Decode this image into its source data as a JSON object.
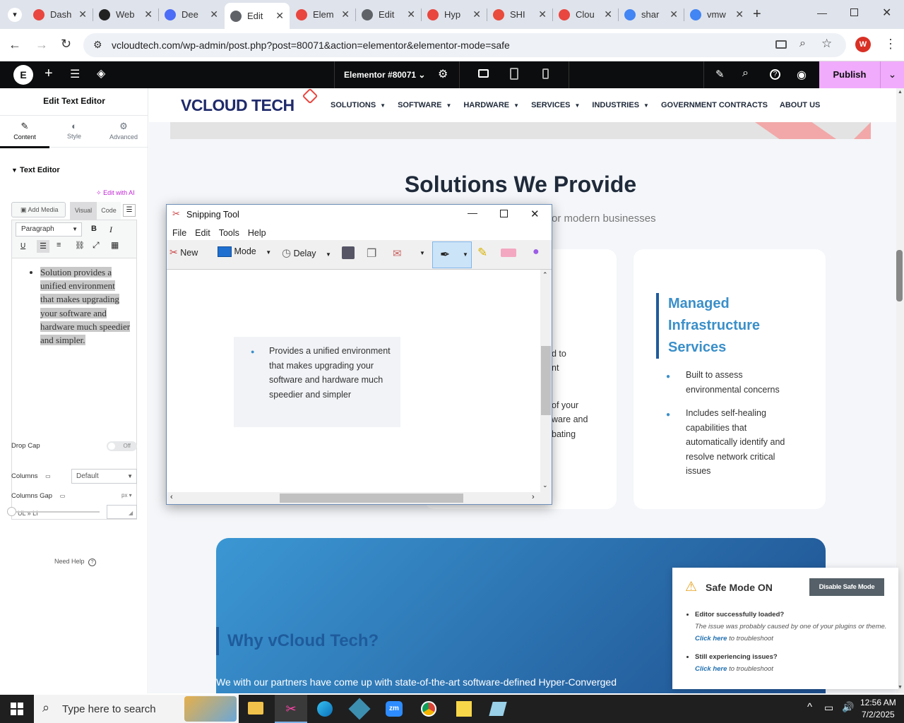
{
  "browser": {
    "tabs": [
      {
        "label": "Dash",
        "color": "#e9463f",
        "active": false
      },
      {
        "label": "Web",
        "color": "#222222",
        "active": false
      },
      {
        "label": "Dee",
        "color": "#4a6cf7",
        "active": false
      },
      {
        "label": "Edit",
        "color": "#5f6368",
        "active": true
      },
      {
        "label": "Elem",
        "color": "#e9463f",
        "active": false
      },
      {
        "label": "Edit",
        "color": "#5f6368",
        "active": false
      },
      {
        "label": "Hyp",
        "color": "#e9463f",
        "active": false
      },
      {
        "label": "SHI",
        "color": "#e94b3c",
        "active": false
      },
      {
        "label": "Clou",
        "color": "#e9463f",
        "active": false
      },
      {
        "label": "shar",
        "color": "#4285f4",
        "active": false
      },
      {
        "label": "vmw",
        "color": "#4285f4",
        "active": false
      }
    ],
    "url": "vcloudtech.com/wp-admin/post.php?post=80071&action=elementor&elementor-mode=safe",
    "profile_initial": "W"
  },
  "elementor_bar": {
    "document_title": "Elementor #80071",
    "publish_label": "Publish"
  },
  "panel": {
    "title": "Edit Text Editor",
    "tabs": [
      "Content",
      "Style",
      "Advanced"
    ],
    "section_title": "Text Editor",
    "edit_with_ai": "Edit with AI",
    "add_media": "Add Media",
    "visual_tab": "Visual",
    "code_tab": "Code",
    "format_select": "Paragraph",
    "editor_text": "Solution provides a unified environment that makes upgrading your software and hardware much speedier and simpler.",
    "path": "UL » LI",
    "drop_cap_label": "Drop Cap",
    "drop_cap_value": "Off",
    "columns_label": "Columns",
    "columns_value": "Default",
    "columns_gap_label": "Columns Gap",
    "columns_gap_unit": "px",
    "need_help": "Need Help"
  },
  "site": {
    "logo": "VCLOUD TECH",
    "nav": [
      "SOLUTIONS",
      "SOFTWARE",
      "HARDWARE",
      "SERVICES",
      "INDUSTRIES",
      "GOVERNMENT CONTRACTS",
      "ABOUT US"
    ],
    "section_title": "Solutions We Provide",
    "section_sub_fragment": "or modern businesses",
    "card_partial_lines": [
      "d to",
      "nt",
      "of your",
      "ware and",
      "bating"
    ],
    "card3_title": "Managed Infrastructure Services",
    "card3_items": [
      "Built to assess environmental concerns",
      "Includes self-healing capabilities that automatically identify and resolve network critical issues"
    ],
    "why_title": "Why vCloud Tech?",
    "why_text": "We with our partners have come up with state-of-the-art software-defined Hyper-Converged"
  },
  "snipping": {
    "title": "Snipping Tool",
    "menu": [
      "File",
      "Edit",
      "Tools",
      "Help"
    ],
    "new_label": "New",
    "mode_label": "Mode",
    "delay_label": "Delay",
    "snip_text": "Provides a unified environment that makes upgrading your software and hardware much speedier and simpler"
  },
  "safe_mode": {
    "title": "Safe Mode ON",
    "button": "Disable Safe Mode",
    "item1_title": "Editor successfully loaded?",
    "item1_text_a": "The issue was probably caused by one of your plugins or theme.",
    "item1_link": "Click here",
    "item1_text_b": "to troubleshoot",
    "item2_title": "Still experiencing issues?",
    "item2_link": "Click here",
    "item2_text_b": "to troubleshoot"
  },
  "taskbar": {
    "search_placeholder": "Type here to search",
    "time": "12:56 AM",
    "date": "7/2/2025"
  }
}
